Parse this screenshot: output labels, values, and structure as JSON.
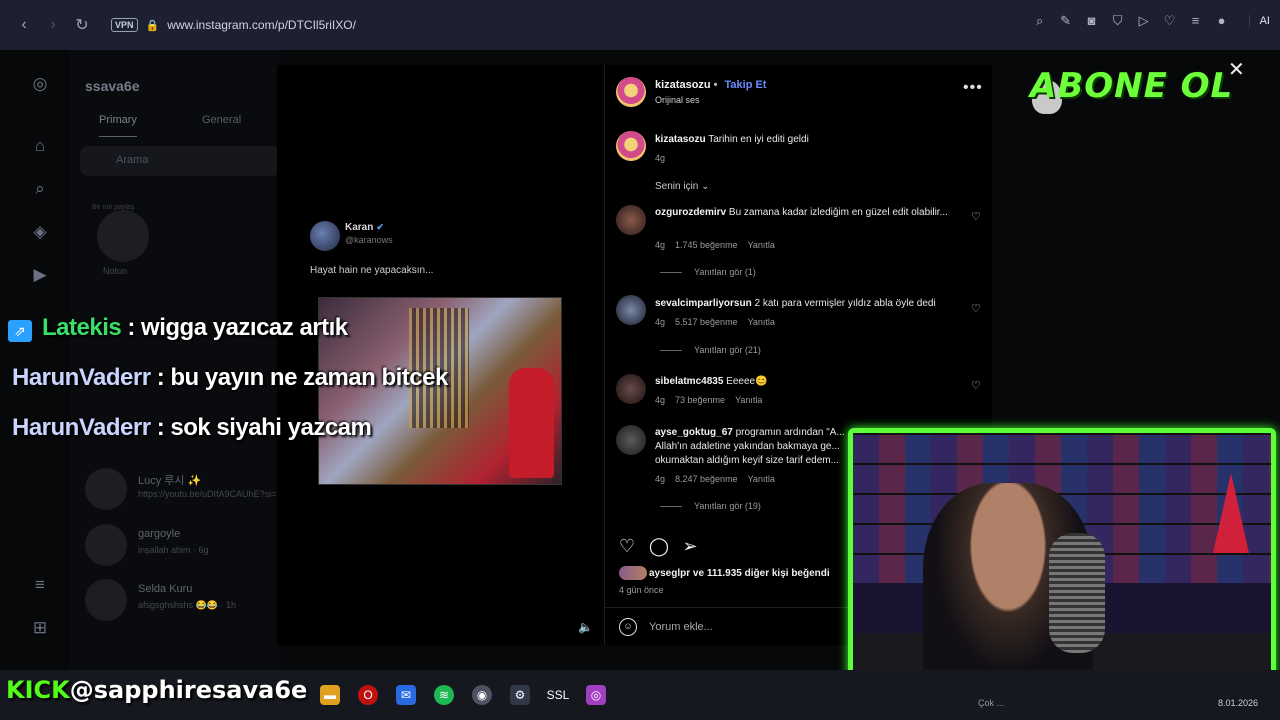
{
  "browser": {
    "url": "www.instagram.com/p/DTCIl5riIXO/",
    "vpn_label": "VPN",
    "ai_label": "AI"
  },
  "dm": {
    "username": "ssava6e",
    "tabs": [
      "Primary",
      "General"
    ],
    "search_placeholder": "Arama",
    "note_label": "Notun",
    "note_bubble": "Bir not paylaş",
    "rows": [
      {
        "name": "Lucy 루시 ✨",
        "sub": "https://youtu.be/uDIfA9CAUhE?si="
      },
      {
        "name": "gargoyle",
        "sub": "inşallah abim · 6g"
      },
      {
        "name": "Selda Kuru",
        "sub": "afsgsghshshs 😂😂 · 1h"
      }
    ]
  },
  "post": {
    "tweet_name": "Karan",
    "tweet_handle": "@karanows",
    "tweet_text": "Hayat hain ne yapacaksın..."
  },
  "panel": {
    "author": "kizatasozu",
    "follow_label": "Takip Et",
    "audio": "Orijinal ses",
    "caption_user": "kizatasozu",
    "caption_text": "Tarihin en iyi editi geldi",
    "caption_age": "4g",
    "sort_label": "Senin için",
    "comments": [
      {
        "user": "ozgurozdemirv",
        "text": "Bu zamana kadar izlediğim en güzel edit olabilir...",
        "age": "4g",
        "likes": "1.745 beğenme",
        "reply": "Yanıtla",
        "replies": "Yanıtları gör (1)"
      },
      {
        "user": "sevalcimparliyorsun",
        "text": "2 katı para vermişler yıldız abla öyle dedi",
        "age": "4g",
        "likes": "5.517 beğenme",
        "reply": "Yanıtla",
        "replies": "Yanıtları gör (21)"
      },
      {
        "user": "sibelatmc4835",
        "text": "Eeeee😊",
        "age": "4g",
        "likes": "73 beğenme",
        "reply": "Yanıtla",
        "replies": ""
      },
      {
        "user": "ayse_goktug_67",
        "text": "programın ardından \"A... Allah'ın adaletine yakından bakmaya ge... okumaktan aldığım keyif size tarif edem...",
        "age": "4g",
        "likes": "8.247 beğenme",
        "reply": "Yanıtla",
        "replies": "Yanıtları gör (19)"
      }
    ],
    "likes_text": "aysegl­pr ve 111.935 diğer kişi beğendi",
    "date": "4 gün önce",
    "comment_placeholder": "Yorum ekle..."
  },
  "overlay": {
    "abone": "ABONE OL",
    "chat": [
      {
        "user": "Latekis",
        "msg": ": wigga yazıcaz artık"
      },
      {
        "user": "HarunVaderr",
        "msg": ": bu yayın ne zaman bitcek"
      },
      {
        "user": "HarunVaderr",
        "msg": ": sok siyahi yazcam"
      }
    ],
    "kick_brand": "KICK",
    "kick_handle": "@sapphiresava6e"
  },
  "taskbar": {
    "date": "8.01.2026",
    "tray_text": "Çok ...",
    "ssl_label": "SSL"
  }
}
